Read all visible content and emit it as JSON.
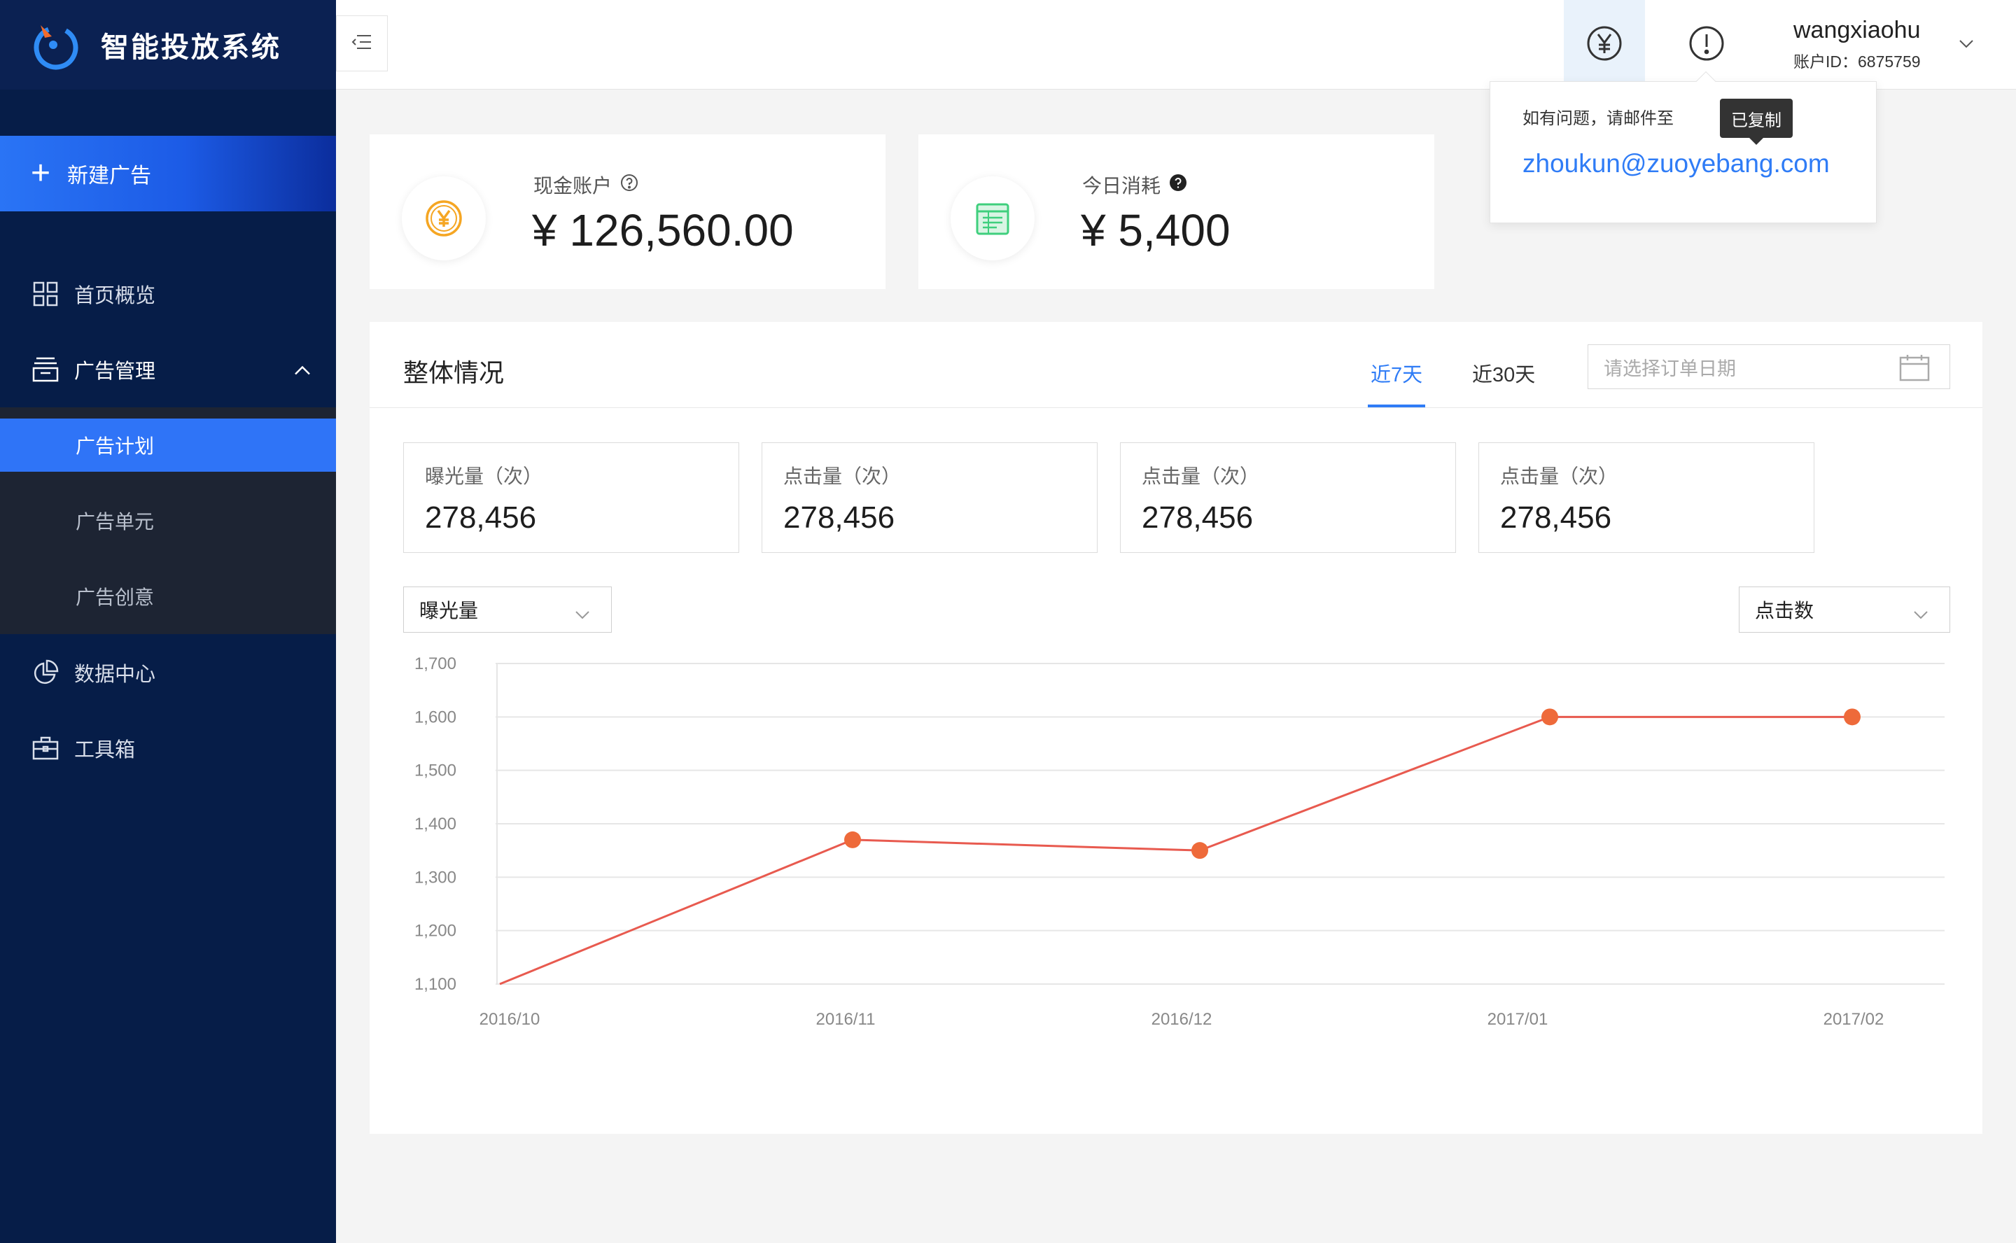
{
  "brand": {
    "name": "智能投放系统"
  },
  "sidebar": {
    "new_ad": "新建广告",
    "items": [
      {
        "label": "首页概览",
        "icon": "grid-icon"
      },
      {
        "label": "广告管理",
        "icon": "archive-icon"
      },
      {
        "label": "数据中心",
        "icon": "pie-chart-icon"
      },
      {
        "label": "工具箱",
        "icon": "toolbox-icon"
      }
    ],
    "subitems": [
      {
        "label": "广告计划",
        "active": true
      },
      {
        "label": "广告单元",
        "active": false
      },
      {
        "label": "广告创意",
        "active": false
      }
    ]
  },
  "header": {
    "username": "wangxiaohu",
    "account_id": "账户ID：6875759"
  },
  "popover": {
    "text": "如有问题，请邮件至",
    "email": "zhoukun@zuoyebang.com",
    "tooltip": "已复制"
  },
  "stats": [
    {
      "label": "现金账户",
      "value": "¥ 126,560.00",
      "icon": "yen-coin-icon"
    },
    {
      "label": "今日消耗",
      "value": "¥ 5,400",
      "icon": "ledger-icon"
    }
  ],
  "overview": {
    "title": "整体情况",
    "tab_7": "近7天",
    "tab_30": "近30天",
    "date_placeholder": "请选择订单日期",
    "metrics": [
      {
        "label": "曝光量（次）",
        "value": "278,456"
      },
      {
        "label": "点击量（次）",
        "value": "278,456"
      },
      {
        "label": "点击量（次）",
        "value": "278,456"
      },
      {
        "label": "点击量（次）",
        "value": "278,456"
      }
    ],
    "select_left": "曝光量",
    "select_right": "点击数"
  },
  "colors": {
    "sidebar_bg": "#061d48",
    "accent_blue": "#2f7cf6",
    "line": "#e85a4f",
    "point": "#ee6a3a"
  },
  "chart_data": {
    "type": "line",
    "categories": [
      "2016/10",
      "2016/11",
      "2016/12",
      "2017/01",
      "2017/02"
    ],
    "values": [
      1100,
      1370,
      1350,
      1600,
      1600
    ],
    "ylim": [
      1100,
      1700
    ],
    "yticks": [
      "1,100",
      "1,200",
      "1,300",
      "1,400",
      "1,500",
      "1,600",
      "1,700"
    ],
    "grid": true
  }
}
